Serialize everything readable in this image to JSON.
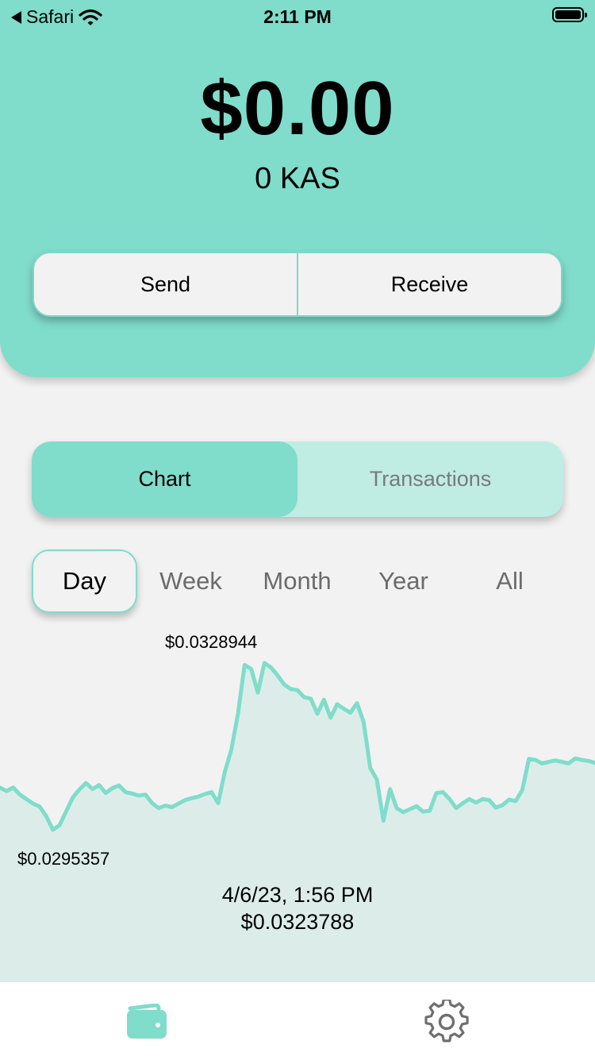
{
  "status_bar": {
    "back_label": "Safari",
    "time": "2:11 PM"
  },
  "balance": {
    "usd": "$0.00",
    "kas": "0 KAS"
  },
  "actions": {
    "send_label": "Send",
    "receive_label": "Receive"
  },
  "segments": [
    {
      "label": "Chart",
      "active": true
    },
    {
      "label": "Transactions",
      "active": false
    }
  ],
  "ranges": [
    {
      "label": "Day",
      "active": true
    },
    {
      "label": "Week",
      "active": false
    },
    {
      "label": "Month",
      "active": false
    },
    {
      "label": "Year",
      "active": false
    },
    {
      "label": "All",
      "active": false
    }
  ],
  "colors": {
    "accent": "#80dccb",
    "accent_light": "#bfece3",
    "chart_fill": "#dcede9",
    "background": "#f2f2f2"
  },
  "tabs": [
    {
      "icon": "wallet-icon",
      "active": true
    },
    {
      "icon": "gear-icon",
      "active": false
    }
  ],
  "chart_data": {
    "type": "area",
    "high_label": "$0.0328944",
    "low_label": "$0.0295357",
    "selected_time": "4/6/23, 1:56 PM",
    "selected_value": "$0.0323788",
    "values": [
      0.03041,
      0.03034,
      0.03041,
      0.03027,
      0.03018,
      0.03009,
      0.03003,
      0.02984,
      0.02957,
      0.02966,
      0.02993,
      0.03021,
      0.03037,
      0.0305,
      0.03038,
      0.03046,
      0.0303,
      0.0304,
      0.03045,
      0.03032,
      0.03029,
      0.03025,
      0.03027,
      0.0301,
      0.03,
      0.03005,
      0.03002,
      0.03009,
      0.03016,
      0.0302,
      0.03023,
      0.03028,
      0.03032,
      0.0301,
      0.03072,
      0.03117,
      0.03188,
      0.03285,
      0.03277,
      0.0323,
      0.03289,
      0.0328,
      0.03264,
      0.03246,
      0.03237,
      0.03235,
      0.03221,
      0.03218,
      0.03188,
      0.03216,
      0.0318,
      0.03207,
      0.03198,
      0.0319,
      0.03209,
      0.03172,
      0.0308,
      0.03057,
      0.02975,
      0.03038,
      0.03,
      0.02992,
      0.02998,
      0.03004,
      0.02993,
      0.02995,
      0.0303,
      0.03032,
      0.03018,
      0.03,
      0.0301,
      0.03018,
      0.03011,
      0.03018,
      0.03016,
      0.03001,
      0.03006,
      0.03017,
      0.03014,
      0.03036,
      0.03098,
      0.03096,
      0.03089,
      0.03092,
      0.03095,
      0.03092,
      0.03089,
      0.03099,
      0.03096,
      0.03094,
      0.0309
    ]
  }
}
